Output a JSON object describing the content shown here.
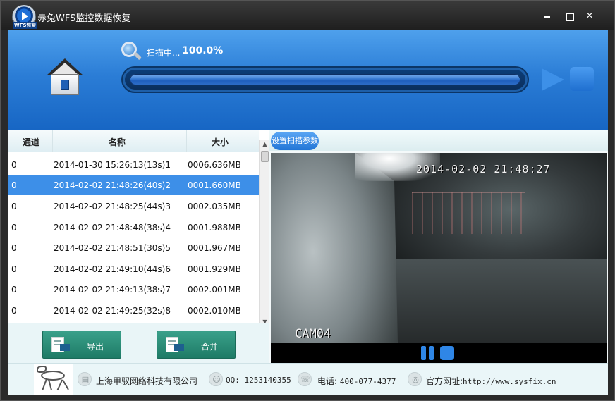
{
  "app": {
    "title": "赤兔WFS监控数据恢复",
    "logo_text": "WFS恢复"
  },
  "header": {
    "scan_status": "扫描中...",
    "scan_percent": "100.0%",
    "progress": 1.0
  },
  "file_list": {
    "columns": [
      "通道",
      "名称",
      "大小"
    ],
    "selected_index": 1,
    "rows": [
      {
        "channel": "0",
        "name": "2014-01-30 15:26:13(13s)1",
        "size": "0006.636MB"
      },
      {
        "channel": "0",
        "name": "2014-02-02 21:48:26(40s)2",
        "size": "0001.660MB"
      },
      {
        "channel": "0",
        "name": "2014-02-02 21:48:25(44s)3",
        "size": "0002.035MB"
      },
      {
        "channel": "0",
        "name": "2014-02-02 21:48:48(38s)4",
        "size": "0001.988MB"
      },
      {
        "channel": "0",
        "name": "2014-02-02 21:48:51(30s)5",
        "size": "0001.967MB"
      },
      {
        "channel": "0",
        "name": "2014-02-02 21:49:10(44s)6",
        "size": "0001.929MB"
      },
      {
        "channel": "0",
        "name": "2014-02-02 21:49:13(38s)7",
        "size": "0002.001MB"
      },
      {
        "channel": "0",
        "name": "2014-02-02 21:49:25(32s)8",
        "size": "0002.010MB"
      }
    ],
    "export_label": "导出",
    "merge_label": "合并"
  },
  "preview": {
    "settings_label": "设置扫描参数",
    "timestamp": "2014-02-02 21:48:27",
    "camera": "CAM04"
  },
  "statusbar": {
    "company": "上海甲驭网络科技有限公司",
    "qq_label": "QQ:",
    "qq_number": "1253140355",
    "phone_label": "电话:",
    "phone_number": "400-077-4377",
    "website_label": "官方网址:",
    "website_url": "http://www.sysfix.cn"
  },
  "colors": {
    "header_blue": "#2b7dd6",
    "selection_blue": "#3d8fe8",
    "action_green": "#2a8f78"
  }
}
